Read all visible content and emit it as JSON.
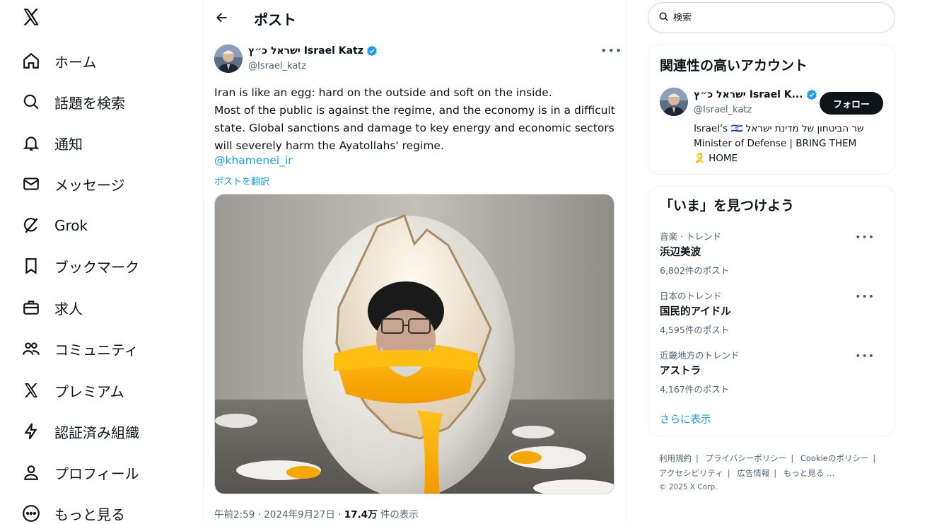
{
  "nav": {
    "items": [
      {
        "label": "ホーム"
      },
      {
        "label": "話題を検索"
      },
      {
        "label": "通知"
      },
      {
        "label": "メッセージ"
      },
      {
        "label": "Grok"
      },
      {
        "label": "ブックマーク"
      },
      {
        "label": "求人"
      },
      {
        "label": "コミュニティ"
      },
      {
        "label": "プレミアム"
      },
      {
        "label": "認証済み組織"
      },
      {
        "label": "プロフィール"
      },
      {
        "label": "もっと見る"
      }
    ]
  },
  "header": {
    "title": "ポスト"
  },
  "post": {
    "author_name": "ישראל כ״ץ Israel Katz",
    "handle": "@Israel_katz",
    "text_lines": [
      "Iran is like an egg: hard on the outside and soft on the inside.",
      "Most of the public is against the regime, and the economy is in a difficult",
      "state. Global sanctions and damage to key energy and economic sectors",
      "will severely harm the Ayatollahs' regime."
    ],
    "mention": "@khamenei_ir",
    "translate": "ポストを翻訳",
    "time": "午前2:59 · 2024年9月27日 · ",
    "views": "17.4万",
    "views_suffix": " 件の表示"
  },
  "search": {
    "placeholder": "検索"
  },
  "relevant": {
    "title": "関連性の高いアカウント",
    "name": "ישראל כ״ץ Israel K...",
    "handle": "@Israel_katz",
    "follow_label": "フォロー",
    "bio_line1": "Israel’s 🇮🇱 שר הביטחון של מדינת ישראל",
    "bio_line2": "Minister of Defense | BRING THEM",
    "bio_line3": "🎗️ HOME"
  },
  "trends": {
    "title": "「いま」を見つけよう",
    "items": [
      {
        "category": "音楽 · トレンド",
        "name": "浜辺美波",
        "count": "6,802件のポスト"
      },
      {
        "category": "日本のトレンド",
        "name": "国民的アイドル",
        "count": "4,595件のポスト"
      },
      {
        "category": "近畿地方のトレンド",
        "name": "アストラ",
        "count": "4,167件のポスト"
      }
    ],
    "show_more": "さらに表示"
  },
  "footer": {
    "links": [
      "利用規約",
      "プライバシーポリシー",
      "Cookieのポリシー",
      "アクセシビリティ",
      "広告情報",
      "もっと見る …"
    ],
    "copyright": "© 2025 X Corp."
  },
  "colors": {
    "accent": "#1d9bf0",
    "text": "#0f1419",
    "muted": "#536471",
    "border": "#eff3f4"
  }
}
